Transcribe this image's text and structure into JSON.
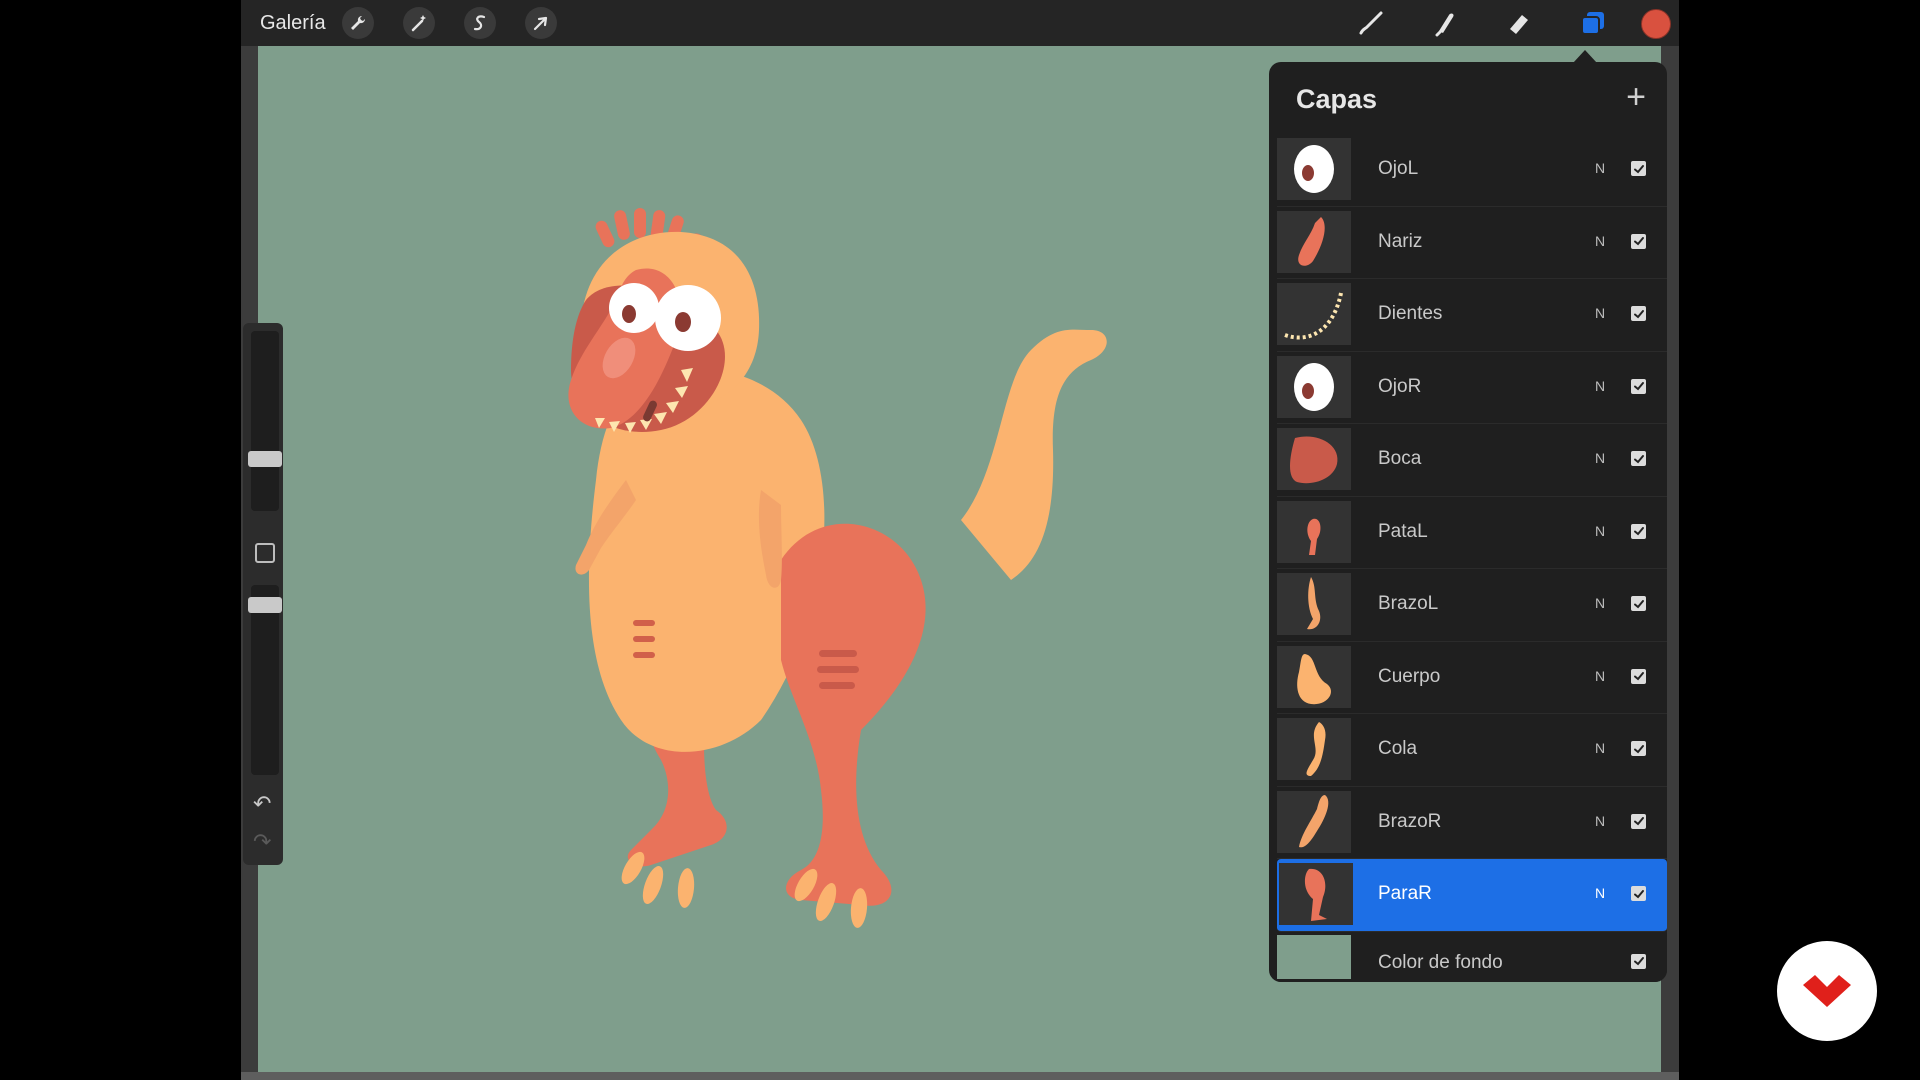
{
  "topbar": {
    "gallery_label": "Galería",
    "left_tools": [
      {
        "name": "actions",
        "icon": "wrench-icon"
      },
      {
        "name": "adjustments",
        "icon": "magic-wand-icon"
      },
      {
        "name": "selection",
        "icon": "selection-s-icon"
      },
      {
        "name": "transform",
        "icon": "arrow-cursor-icon"
      }
    ],
    "right_tools": [
      {
        "name": "brush",
        "icon": "brush-icon"
      },
      {
        "name": "smudge",
        "icon": "smudge-icon"
      },
      {
        "name": "eraser",
        "icon": "eraser-icon"
      },
      {
        "name": "layers",
        "icon": "layers-icon",
        "active": true
      }
    ],
    "current_color": "#d9513f"
  },
  "sidebar": {
    "brush_size_level": 0.72,
    "opacity_level": 0.9,
    "undo_icon": "undo-icon",
    "redo_icon": "redo-icon"
  },
  "layers_panel": {
    "title": "Capas",
    "add_label": "+",
    "layers": [
      {
        "name": "OjoL",
        "blend": "N",
        "visible": true,
        "thumb": "eye"
      },
      {
        "name": "Nariz",
        "blend": "N",
        "visible": true,
        "thumb": "nose"
      },
      {
        "name": "Dientes",
        "blend": "N",
        "visible": true,
        "thumb": "teeth"
      },
      {
        "name": "OjoR",
        "blend": "N",
        "visible": true,
        "thumb": "eye"
      },
      {
        "name": "Boca",
        "blend": "N",
        "visible": true,
        "thumb": "mouth"
      },
      {
        "name": "PataL",
        "blend": "N",
        "visible": true,
        "thumb": "leg"
      },
      {
        "name": "BrazoL",
        "blend": "N",
        "visible": true,
        "thumb": "arm"
      },
      {
        "name": "Cuerpo",
        "blend": "N",
        "visible": true,
        "thumb": "body"
      },
      {
        "name": "Cola",
        "blend": "N",
        "visible": true,
        "thumb": "tail"
      },
      {
        "name": "BrazoR",
        "blend": "N",
        "visible": true,
        "thumb": "arm2"
      },
      {
        "name": "ParaR",
        "blend": "N",
        "visible": true,
        "thumb": "leg2",
        "active": true
      }
    ],
    "background_layer": {
      "name": "Color de fondo",
      "visible": true,
      "color": "#7f9e8c"
    }
  },
  "colors": {
    "canvas": "#7f9e8c",
    "accent": "#1d6fe6",
    "dino_body": "#fbb36f",
    "dino_red": "#e8735a",
    "dino_dark": "#c95a4a"
  },
  "watermark_icon": "brand-logo-icon"
}
